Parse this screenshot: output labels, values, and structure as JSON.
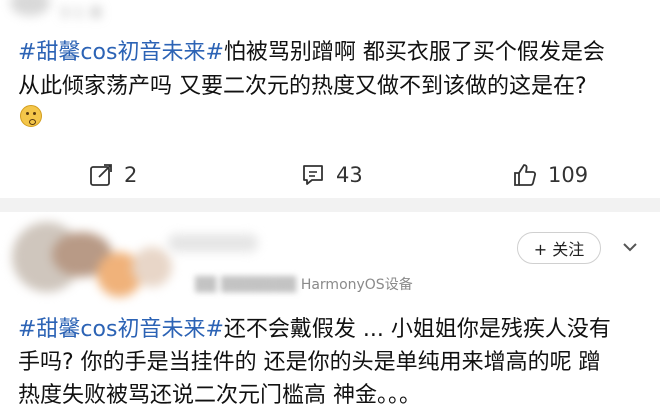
{
  "post1": {
    "meta_partial": "3-1 来",
    "line1_tag": "#甜馨cos初音未来#",
    "line1_text": "怕被骂别蹭啊 都买衣服了买个假发是会",
    "line2": "从此倾家荡产吗 又要二次元的热度又做不到该做的这是在?",
    "emoji": "thinking-face-emoji",
    "actions": {
      "share_count": "2",
      "comment_count": "43",
      "like_count": "109"
    }
  },
  "post2": {
    "follow_label": "+ 关注",
    "device": "HarmonyOS设备",
    "line1_tag": "#甜馨cos初音未来#",
    "line1_text": "还不会戴假发 ... 小姐姐你是残疾人没有",
    "line2": "手吗? 你的手是当挂件的 还是你的头是单纯用来增高的呢 蹭",
    "line3": "热度失败被骂还说二次元门槛高 神金。。。"
  },
  "colors": {
    "tag": "#2c63b5",
    "divider": "#f2f2f2",
    "text": "#111111"
  }
}
